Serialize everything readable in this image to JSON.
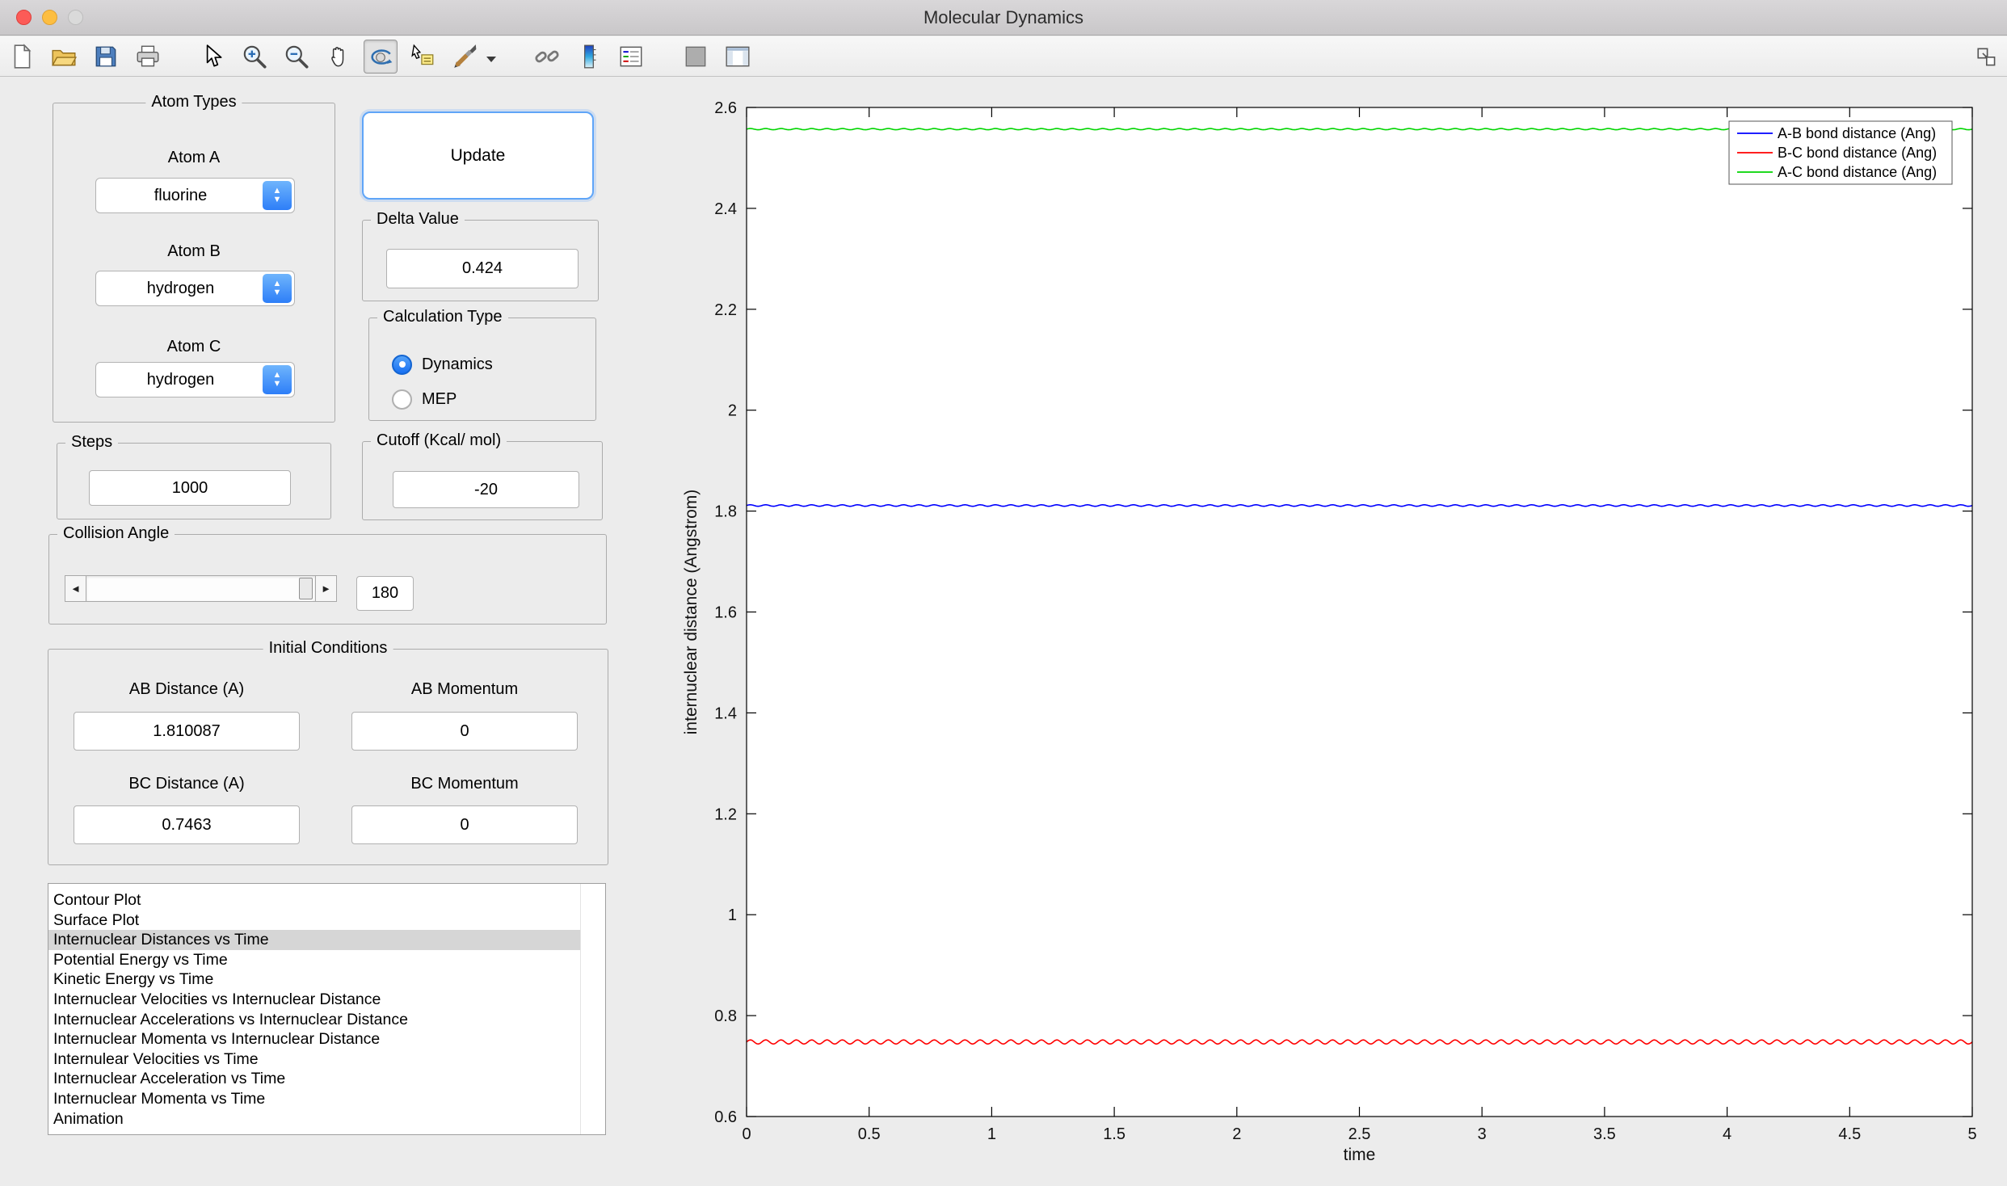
{
  "window": {
    "title": "Molecular Dynamics"
  },
  "toolbar": {
    "buttons": [
      "new-figure",
      "open-file",
      "save-figure",
      "print-figure",
      "edit-plot",
      "zoom-in",
      "zoom-out",
      "pan",
      "rotate-3d",
      "data-cursor",
      "brush",
      "link-plot",
      "insert-colorbar",
      "insert-legend",
      "hide-plot-tools",
      "show-plot-tools",
      "dock-figure"
    ],
    "active_button": "rotate-3d"
  },
  "controls": {
    "atom_types": {
      "title": "Atom Types",
      "atom_a_label": "Atom A",
      "atom_a_value": "fluorine",
      "atom_b_label": "Atom B",
      "atom_b_value": "hydrogen",
      "atom_c_label": "Atom C",
      "atom_c_value": "hydrogen"
    },
    "update_button": "Update",
    "delta_value": {
      "title": "Delta Value",
      "value": "0.424"
    },
    "calculation_type": {
      "title": "Calculation Type",
      "options": [
        "Dynamics",
        "MEP"
      ],
      "selected": "Dynamics"
    },
    "steps": {
      "title": "Steps",
      "value": "1000"
    },
    "cutoff": {
      "title": "Cutoff (Kcal/ mol)",
      "value": "-20"
    },
    "collision_angle": {
      "title": "Collision Angle",
      "value": "180"
    },
    "initial_conditions": {
      "title": "Initial Conditions",
      "ab_distance_label": "AB Distance (A)",
      "ab_distance_value": "1.810087",
      "ab_momentum_label": "AB Momentum",
      "ab_momentum_value": "0",
      "bc_distance_label": "BC Distance (A)",
      "bc_distance_value": "0.7463",
      "bc_momentum_label": "BC Momentum",
      "bc_momentum_value": "0"
    },
    "plot_list": {
      "items": [
        "Contour Plot",
        "Surface Plot",
        "Internuclear Distances vs Time",
        "Potential Energy vs Time",
        "Kinetic Energy vs Time",
        "Internuclear Velocities vs Internuclear Distance",
        "Internuclear Accelerations vs Internuclear Distance",
        "Internuclear Momenta vs Internuclear Distance",
        "Internulear Velocities vs Time",
        "Internuclear Acceleration vs Time",
        "Internuclear Momenta vs Time",
        "Animation"
      ],
      "selected_index": 2
    }
  },
  "chart_data": {
    "type": "line",
    "title": "",
    "xlabel": "time",
    "ylabel": "internuclear distance (Angstrom)",
    "xlim": [
      0,
      5
    ],
    "ylim": [
      0.6,
      2.6
    ],
    "xticks": [
      0,
      0.5,
      1,
      1.5,
      2,
      2.5,
      3,
      3.5,
      4,
      4.5,
      5
    ],
    "yticks": [
      0.6,
      0.8,
      1,
      1.2,
      1.4,
      1.6,
      1.8,
      2,
      2.2,
      2.4,
      2.6
    ],
    "grid": false,
    "legend_position": "top-right",
    "series": [
      {
        "name": "A-B bond distance (Ang)",
        "color": "#0000ff",
        "mean": 1.811,
        "amplitude": 0.0015,
        "cycles": 80
      },
      {
        "name": "B-C bond distance (Ang)",
        "color": "#ff0000",
        "mean": 0.7478,
        "amplitude": 0.004,
        "cycles": 80
      },
      {
        "name": "A-C bond distance (Ang)",
        "color": "#00d500",
        "mean": 2.557,
        "amplitude": 0.0012,
        "cycles": 80
      }
    ]
  }
}
